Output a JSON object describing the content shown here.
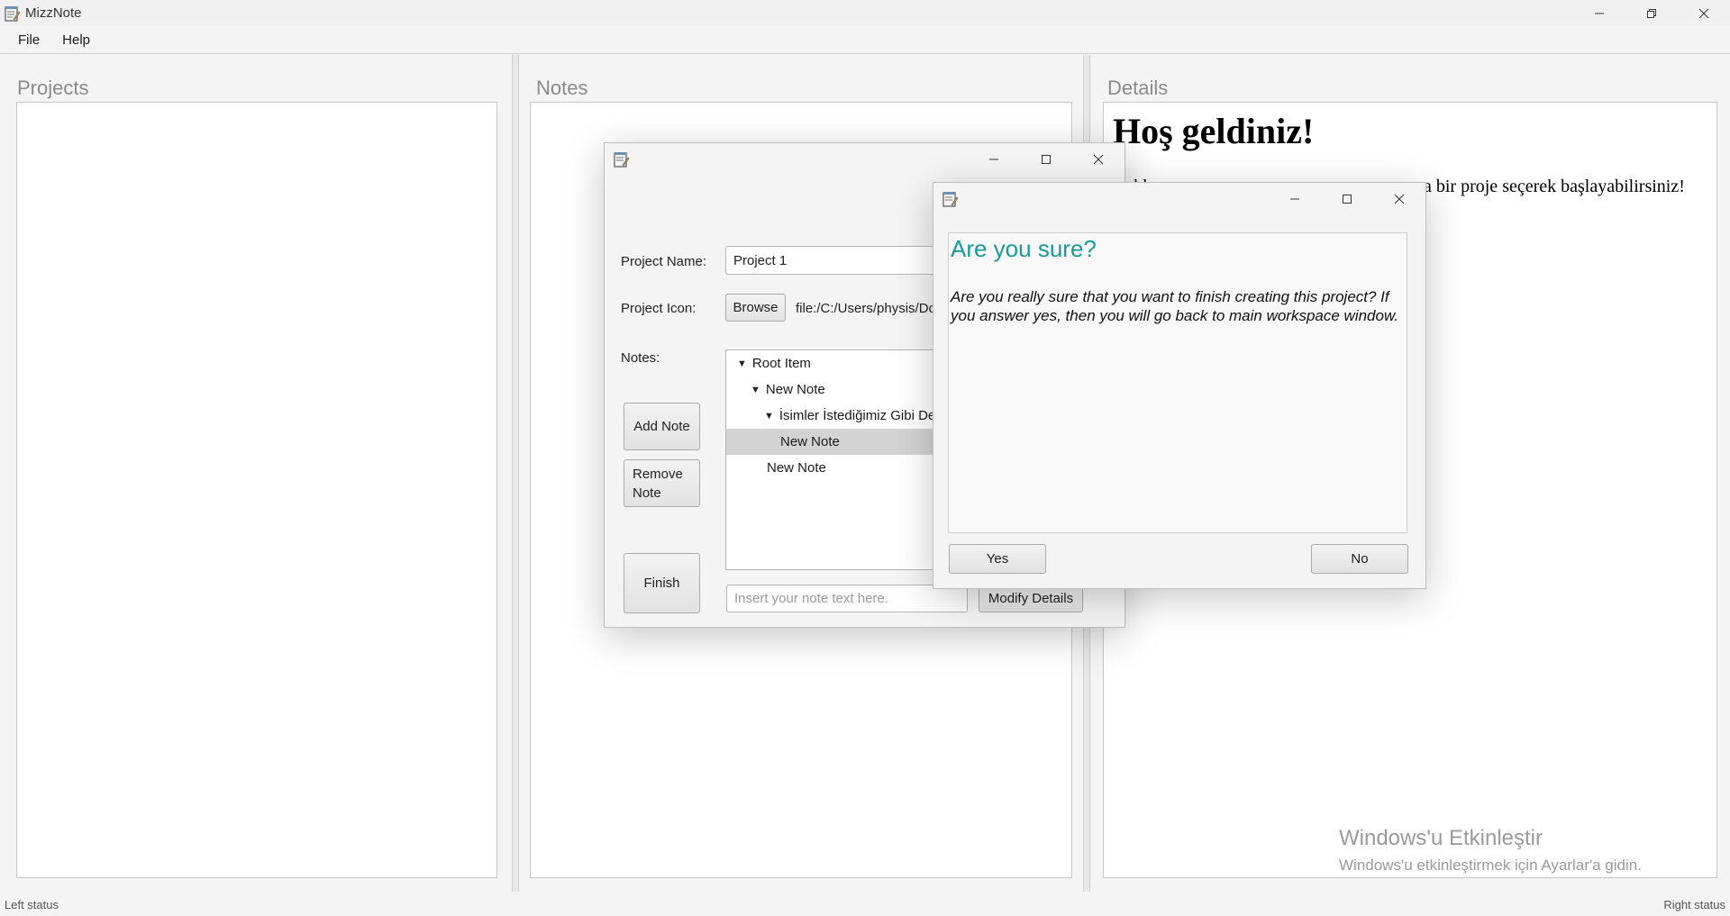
{
  "app": {
    "title": "MizzNote"
  },
  "menu": {
    "file": "File",
    "help": "Help"
  },
  "panes": {
    "projects": "Projects",
    "notes": "Notes",
    "details": "Details"
  },
  "details": {
    "heading": "Hoş geldiniz!",
    "text_left": "…kl",
    "text_right": "a bir proje seçerek başlayabilirsiniz!"
  },
  "watermark": {
    "line1": "Windows'u Etkinleştir",
    "line2": "Windows'u etkinleştirmek için Ayarlar'a gidin."
  },
  "status": {
    "left": "Left status",
    "right": "Right status"
  },
  "new_project_dialog": {
    "project_name_label": "Project Name:",
    "project_name_value": "Project 1",
    "project_icon_label": "Project Icon:",
    "browse_label": "Browse",
    "icon_path": "file:/C:/Users/physis/Do",
    "notes_label": "Notes:",
    "add_note": "Add Note",
    "remove_note": "Remove Note",
    "finish": "Finish",
    "note_text_placeholder": "Insert your note text here.",
    "modify_details": "Modify Details",
    "tree": [
      {
        "label": "Root Item",
        "level": 0,
        "expanded": true,
        "selected": false
      },
      {
        "label": "New Note",
        "level": 1,
        "expanded": true,
        "selected": false
      },
      {
        "label": "İsimler İstediğimiz Gibi De",
        "level": 2,
        "expanded": true,
        "selected": false
      },
      {
        "label": "New Note",
        "level": 3,
        "expanded": false,
        "selected": true
      },
      {
        "label": "New Note",
        "level": 2,
        "expanded": false,
        "selected": false
      }
    ]
  },
  "confirm_dialog": {
    "title": "Are you sure?",
    "message": "Are you really sure that you want to finish creating this project? If you answer yes, then you will go back to main workspace window.",
    "yes": "Yes",
    "no": "No"
  },
  "colors": {
    "confirm_title": "#1a9a9a",
    "selected_row": "#d3d3d3"
  }
}
